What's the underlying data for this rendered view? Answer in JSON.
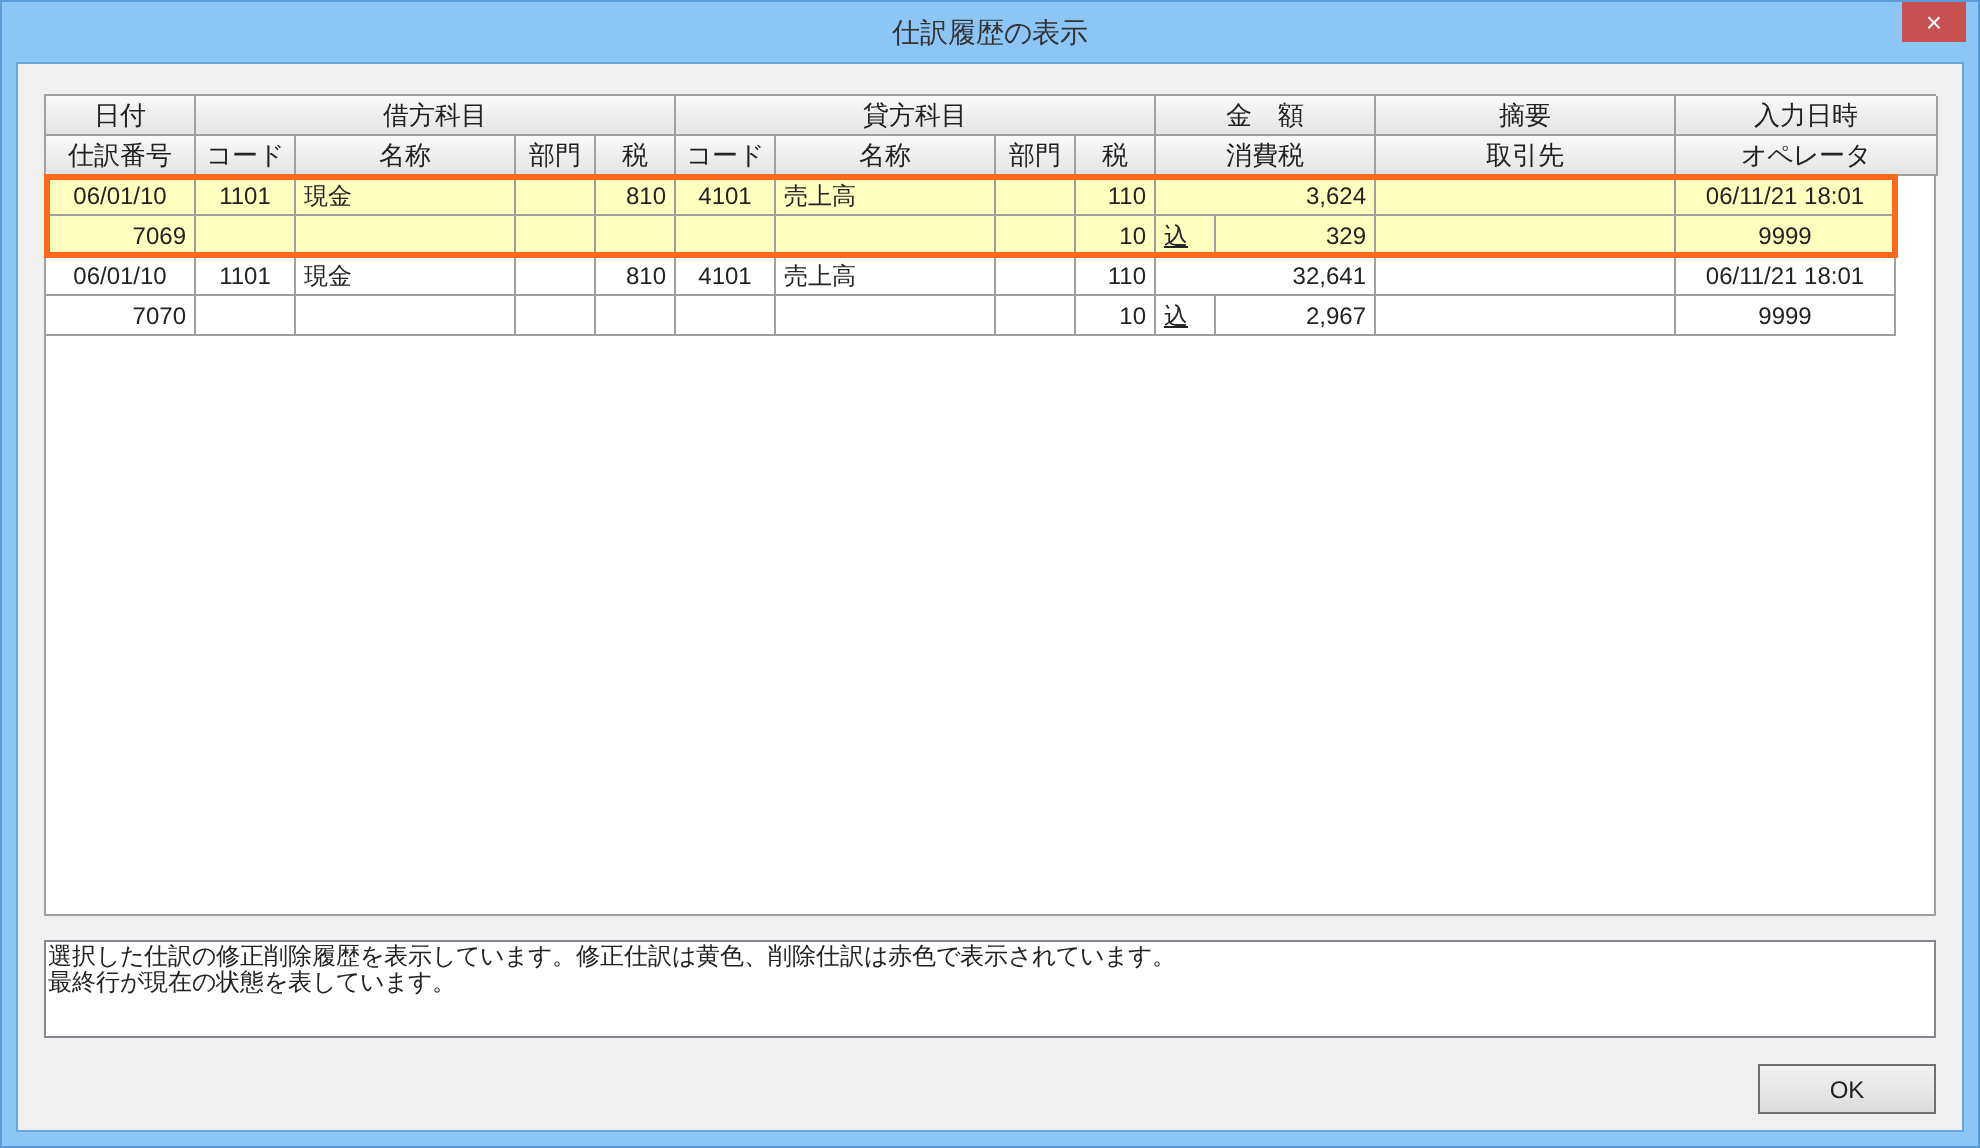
{
  "window": {
    "title": "仕訳履歴の表示",
    "close": "×"
  },
  "table": {
    "group_headers": [
      "日付",
      "借方科目",
      "貸方科目",
      "金　額",
      "摘要",
      "入力日時"
    ],
    "columns": [
      "仕訳番号",
      "コード",
      "名称",
      "部門",
      "税",
      "コード",
      "名称",
      "部門",
      "税",
      "消費税",
      "取引先",
      "オペレータ"
    ],
    "entries": [
      {
        "kind": "modified",
        "selected": true,
        "date": "06/01/10",
        "debit_code": "1101",
        "debit_name": "現金",
        "debit_tax": "810",
        "credit_code": "4101",
        "credit_name": "売上高",
        "credit_tax": "110",
        "amount": "3,624",
        "input_time": "06/11/21 18:01",
        "number": "7069",
        "tax_code": "10",
        "tax_mode": "込",
        "tax_amount": "329",
        "operator": "9999"
      },
      {
        "kind": "current",
        "selected": false,
        "date": "06/01/10",
        "debit_code": "1101",
        "debit_name": "現金",
        "debit_tax": "810",
        "credit_code": "4101",
        "credit_name": "売上高",
        "credit_tax": "110",
        "amount": "32,641",
        "input_time": "06/11/21 18:01",
        "number": "7070",
        "tax_code": "10",
        "tax_mode": "込",
        "tax_amount": "2,967",
        "operator": "9999"
      }
    ]
  },
  "message": [
    "選択した仕訳の修正削除履歴を表示しています。修正仕訳は黄色、削除仕訳は赤色で表示されています。",
    "最終行が現在の状態を表しています。"
  ],
  "buttons": [
    "OK"
  ]
}
